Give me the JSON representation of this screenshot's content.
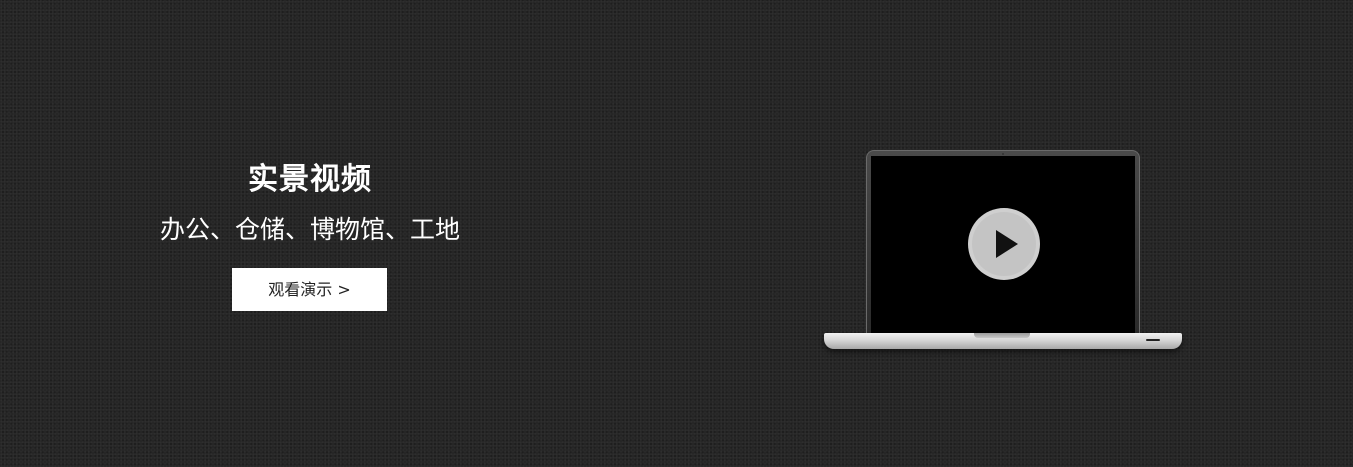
{
  "banner": {
    "title": "实景视频",
    "subtitle": "办公、仓储、博物馆、工地",
    "demo_button_label": "观看演示 >"
  },
  "laptop": {
    "play_icon": "play-icon",
    "screen_color": "#000000",
    "play_circle_color": "#cfcfcf"
  },
  "colors": {
    "background": "#262626",
    "text": "#ffffff",
    "button_background": "#ffffff",
    "button_text": "#222222"
  }
}
